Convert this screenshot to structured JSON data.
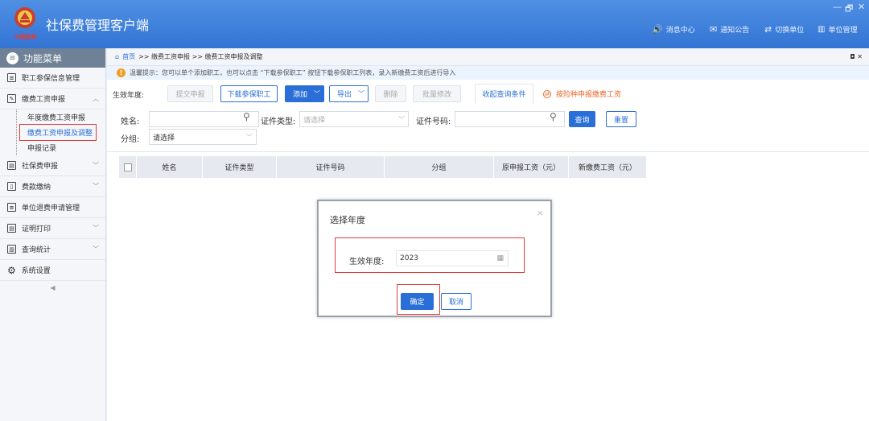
{
  "app": {
    "title": "社保费管理客户端",
    "seal_text": "中国税务"
  },
  "window": {
    "minimize": "—",
    "restore": "🗗",
    "close": "✕"
  },
  "top_nav": [
    {
      "icon": "speaker-icon",
      "label": "消息中心"
    },
    {
      "icon": "mail-icon",
      "label": "通知公告"
    },
    {
      "icon": "switch-icon",
      "label": "切换单位"
    },
    {
      "icon": "building-icon",
      "label": "单位管理"
    }
  ],
  "sidebar": {
    "header": "功能菜单",
    "items": [
      {
        "label": "职工参保信息管理"
      },
      {
        "label": "缴费工资申报"
      },
      {
        "label": "社保费申报"
      },
      {
        "label": "费款缴纳"
      },
      {
        "label": "单位退费申请管理"
      },
      {
        "label": "证明打印"
      },
      {
        "label": "查询统计"
      },
      {
        "label": "系统设置"
      }
    ],
    "sub_items": [
      "年度缴费工资申报",
      "缴费工资申报及调整",
      "申报记录"
    ],
    "collapse": "◀"
  },
  "breadcrumb": {
    "home": "首页",
    "path": ">> 缴费工资申报 >> 缴费工资申报及调整",
    "ctrl": "◘ ✕"
  },
  "tip": "温馨提示：您可以单个添加职工，也可以点击 “下载参保职工” 按钮下载参保职工列表，录入新缴费工资后进行导入",
  "toolbar": {
    "year_label": "生效年度:",
    "submit": "提交申报",
    "download": "下载参保职工",
    "add": "添加",
    "export": "导出",
    "delete": "删除",
    "batch": "批量修改",
    "collapse": "收起查询条件",
    "by_type": "按险种申报缴费工资"
  },
  "search": {
    "name_label": "姓名:",
    "idtype_label": "证件类型:",
    "idtype_placeholder": "请选择",
    "idno_label": "证件号码:",
    "query": "查询",
    "reset": "重置",
    "group_label": "分组:",
    "group_placeholder": "请选择"
  },
  "table": {
    "headers": [
      "姓名",
      "证件类型",
      "证件号码",
      "分组",
      "原申报工资（元）",
      "新缴费工资（元）"
    ]
  },
  "dialog": {
    "title": "选择年度",
    "close": "×",
    "year_label": "生效年度:",
    "year_value": "2023",
    "ok": "确定",
    "cancel": "取消"
  }
}
